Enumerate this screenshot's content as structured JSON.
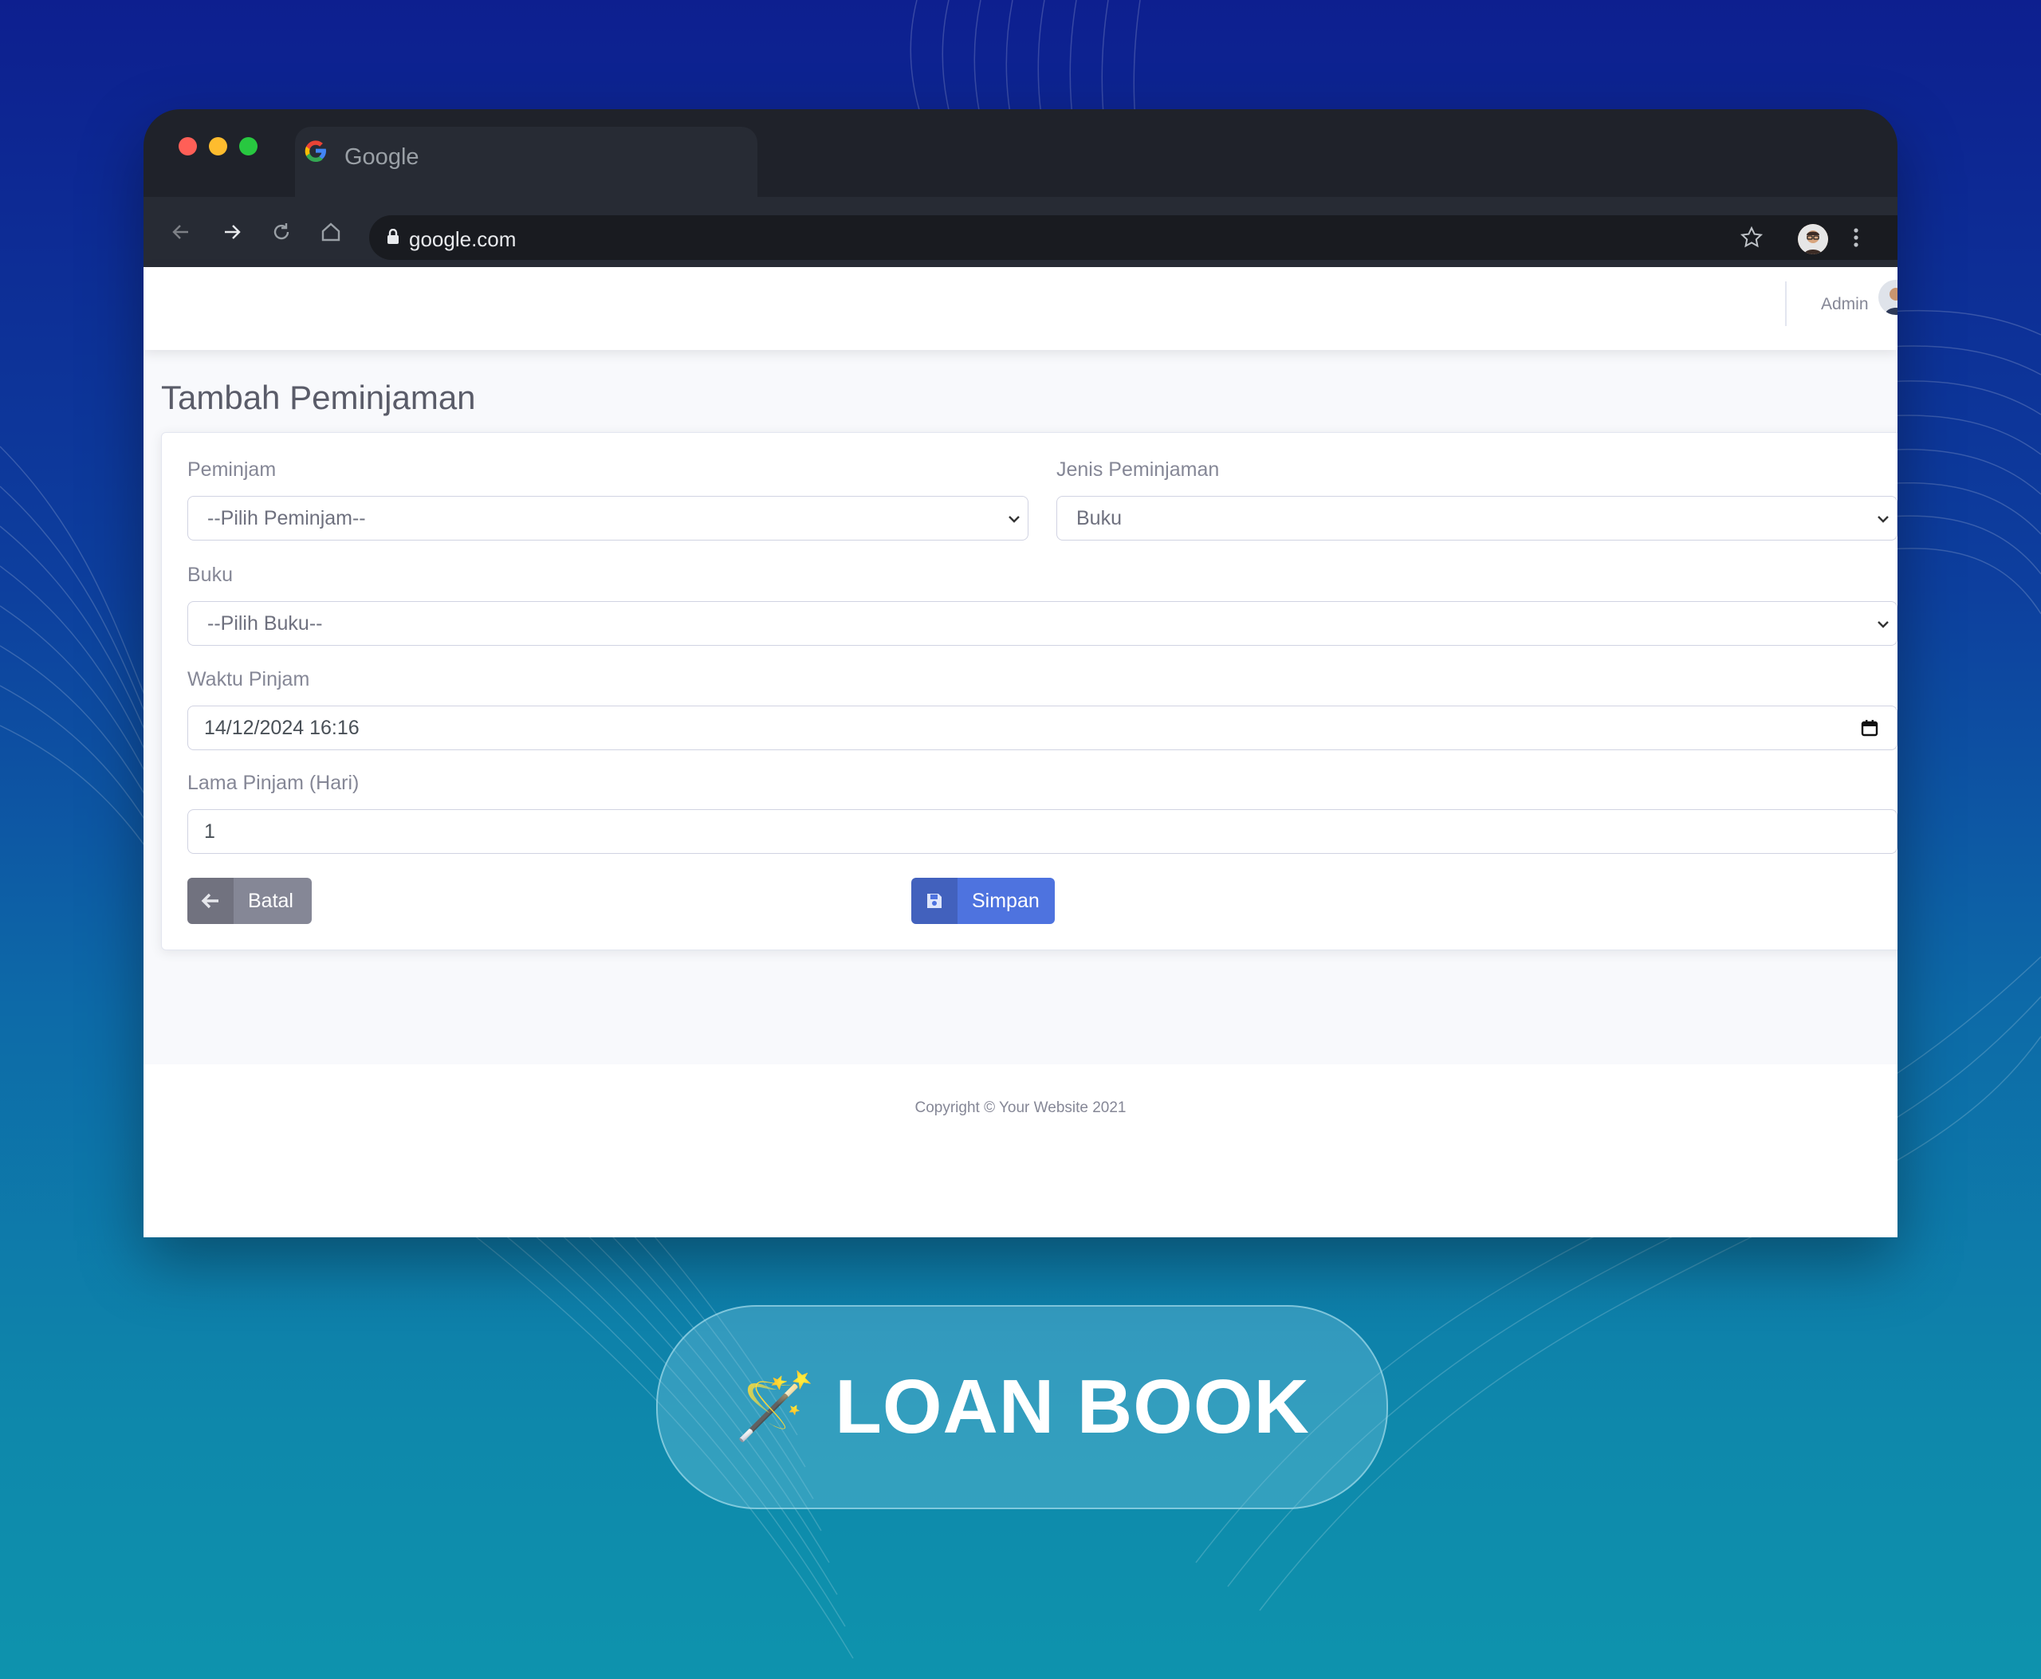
{
  "browser": {
    "tab_title": "Google",
    "url": "google.com"
  },
  "header": {
    "user_name": "Admin"
  },
  "page": {
    "title": "Tambah Peminjaman"
  },
  "form": {
    "peminjam_label": "Peminjam",
    "peminjam_value": "--Pilih Peminjam--",
    "jenis_label": "Jenis Peminjaman",
    "jenis_value": "Buku",
    "buku_label": "Buku",
    "buku_value": "--Pilih Buku--",
    "waktu_label": "Waktu Pinjam",
    "waktu_value": "14/12/2024 16:16",
    "lama_label": "Lama Pinjam (Hari)",
    "lama_value": "1",
    "cancel_label": "Batal",
    "save_label": "Simpan"
  },
  "footer": {
    "copyright": "Copyright © Your Website 2021"
  },
  "banner": {
    "emoji": "🪄",
    "title": "LOAN BOOK"
  },
  "colors": {
    "primary": "#4e73df",
    "secondary": "#858796",
    "browser_dark": "#1f222a"
  }
}
